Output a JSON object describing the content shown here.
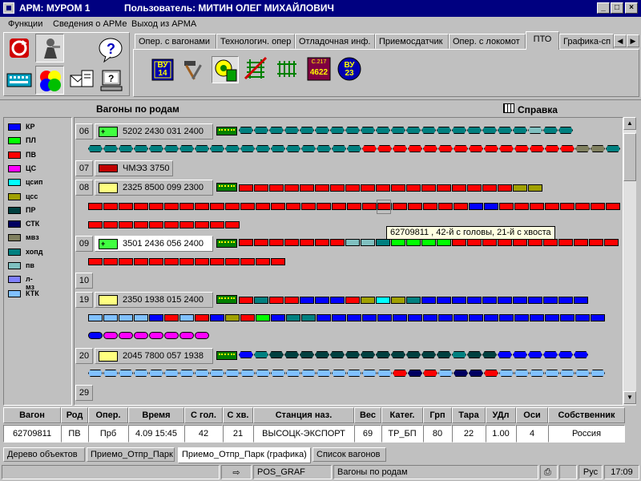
{
  "window": {
    "app_title": "АРМ: МУРОМ 1",
    "user_label": "Пользователь: МИТИН ОЛЕГ МИХАЙЛОВИЧ",
    "minimize": "_",
    "maximize": "□",
    "close": "×"
  },
  "menu": [
    "Функции",
    "Сведения о АРМе",
    "Выход из АРМА"
  ],
  "tabs": [
    "Опер. с вагонами",
    "Технологич. опер",
    "Отладочная инф.",
    "Приемосдатчик",
    "Опер. с локомот",
    "ПТО",
    "Графика-сп"
  ],
  "active_tab": "ПТО",
  "toolbar": {
    "vu14_line1": "ВУ",
    "vu14_line2": "14",
    "vu23_line1": "ВУ",
    "vu23_line2": "23",
    "c217_line1": "C.217",
    "c217_line2": "4622",
    "icons": [
      "hammer-wrench-icon",
      "gear-shield-icon",
      "crossed-rail-icon",
      "rail-track-icon"
    ]
  },
  "left_toolbar_icons": [
    "refresh-red-icon",
    "worker-icon",
    "help-bubble-icon",
    "keyboard-icon",
    "color-circles-icon",
    "documents-icon",
    "computer-help-icon"
  ],
  "panel": {
    "title": "Вагоны по родам",
    "help_label": "Справка"
  },
  "legend": [
    {
      "code": "КР",
      "color": "#0000ff"
    },
    {
      "code": "ПЛ",
      "color": "#00ff00"
    },
    {
      "code": "ПВ",
      "color": "#ff0000"
    },
    {
      "code": "ЦС",
      "color": "#ff00ff"
    },
    {
      "code": "цсип",
      "color": "#00ffff"
    },
    {
      "code": "цсс",
      "color": "#a0a000"
    },
    {
      "code": "ПР",
      "color": "#004040"
    },
    {
      "code": "СТК",
      "color": "#000060"
    },
    {
      "code": "мвз",
      "color": "#808060"
    },
    {
      "code": "хопд",
      "color": "#008080"
    },
    {
      "code": "пв",
      "color": "#80c0c0"
    },
    {
      "code": "л-мз",
      "color": "#8080ff"
    },
    {
      "code": "КТК",
      "color": "#80c0ff"
    }
  ],
  "tracks": [
    {
      "no": "06",
      "train": "5202  2430 031 2400",
      "doc": "green",
      "doc_label": "+"
    },
    {
      "no": "07",
      "train": "ЧМЭЗ 3750",
      "doc": "loco"
    },
    {
      "no": "08",
      "train": "2325  8500 099 2300",
      "doc": "yellow"
    },
    {
      "no": "09",
      "train": "3501  2436 056 2400",
      "doc": "green",
      "doc_label": "+",
      "selected": true
    },
    {
      "no": "10",
      "train": ""
    },
    {
      "no": "19",
      "train": "2350  1938 015 2400",
      "doc": "yellow"
    },
    {
      "no": "20",
      "train": "2045  7800 057 1938",
      "doc": "yellow"
    },
    {
      "no": "29",
      "train": ""
    }
  ],
  "tooltip": "62709811 , 42-й с головы, 21-й с хвоста",
  "table": {
    "headers": [
      "Вагон",
      "Род",
      "Опер.",
      "Время",
      "С гол.",
      "С хв.",
      "Станция наз.",
      "Вес",
      "Катег.",
      "Грп",
      "Тара",
      "УДл",
      "Оси",
      "Собственник"
    ],
    "row": [
      "62709811",
      "ПВ",
      "Прб",
      "4.09 15:45",
      "42",
      "21",
      "ВЫСОЦК-ЭКСПОРТ",
      "69",
      "ТР_БП",
      "80",
      "22",
      "1.00",
      "4",
      "Россия"
    ]
  },
  "bottom_tabs": [
    "Дерево объектов",
    "Приемо_Отпр_Парк",
    "Приемо_Отпр_Парк (графика)",
    "Список вагонов"
  ],
  "active_bottom_tab": "Приемо_Отпр_Парк (графика)",
  "status": {
    "module": "POS_GRAF",
    "view": "Вагоны по родам",
    "lang": "Рус",
    "clock": "17:09"
  }
}
